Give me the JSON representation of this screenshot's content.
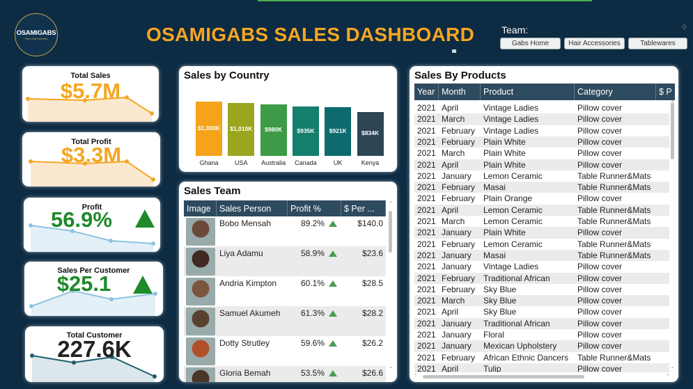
{
  "header": {
    "logo_text": "OSAMIGABS",
    "logo_subtext": "Fibre Craft Industries",
    "title": "OSAMIGABS SALES DASHBOARD",
    "team_label": "Team:",
    "team_buttons": [
      "Gabs Home",
      "Hair Accessories",
      "Tablewares"
    ]
  },
  "colors": {
    "background": "#0d2b42",
    "title": "#f5a623",
    "orange": "#f5a623",
    "green": "#1e8a2a",
    "dark": "#222222"
  },
  "kpis": [
    {
      "label": "Total Sales",
      "value": "$5.7M",
      "color": "#f5a623",
      "trend": "orange-area"
    },
    {
      "label": "Total Profit",
      "value": "$3.3M",
      "color": "#f5a623",
      "trend": "orange-area"
    },
    {
      "label": "Profit",
      "value": "56.9%",
      "color": "#1e8a2a",
      "icon": "up-triangle-icon",
      "trend": "blue-area"
    },
    {
      "label": "Sales Per Customer",
      "value": "$25.1",
      "color": "#1e8a2a",
      "icon": "up-triangle-icon",
      "trend": "blue-area"
    },
    {
      "label": "Total Customer",
      "value": "227.6K",
      "color": "#222222",
      "trend": "teal-area"
    }
  ],
  "sales_by_country": {
    "title": "Sales by Country",
    "chart_data": {
      "type": "bar",
      "categories": [
        "Ghana",
        "USA",
        "Australia",
        "Canada",
        "UK",
        "Kenya"
      ],
      "values": [
        1030,
        1010,
        980,
        935,
        921,
        834
      ],
      "data_labels": [
        "$1,030K",
        "$1,010K",
        "$980K",
        "$935K",
        "$921K",
        "$834K"
      ],
      "colors": [
        "#f5a31a",
        "#9aa71e",
        "#3d9b48",
        "#147f6c",
        "#0d6a6e",
        "#2d4656"
      ]
    }
  },
  "sales_team": {
    "title": "Sales Team",
    "columns": [
      "Image",
      "Sales Person",
      "Profit %",
      "$ Per ..."
    ],
    "rows": [
      {
        "name": "Bobo Mensah",
        "profit": "89.2%",
        "per": "$140.0"
      },
      {
        "name": "Liya Adamu",
        "profit": "58.9%",
        "per": "$23.6"
      },
      {
        "name": "Andria Kimpton",
        "profit": "60.1%",
        "per": "$28.5"
      },
      {
        "name": "Samuel Akumeh",
        "profit": "61.3%",
        "per": "$28.2"
      },
      {
        "name": "Dotty Strutley",
        "profit": "59.6%",
        "per": "$26.2"
      },
      {
        "name": "Gloria Bemah",
        "profit": "53.5%",
        "per": "$26.6"
      }
    ]
  },
  "sales_by_products": {
    "title": "Sales By Products",
    "columns": [
      "Year",
      "Month",
      "Product",
      "Category",
      "$ P"
    ],
    "rows": [
      [
        "2021",
        "April",
        "Vintage Ladies",
        "Pillow cover"
      ],
      [
        "2021",
        "March",
        "Vintage Ladies",
        "Pillow cover"
      ],
      [
        "2021",
        "February",
        "Vintage Ladies",
        "Pillow cover"
      ],
      [
        "2021",
        "February",
        "Plain White",
        "Pillow cover"
      ],
      [
        "2021",
        "March",
        "Plain White",
        "Pillow cover"
      ],
      [
        "2021",
        "April",
        "Plain White",
        "Pillow cover"
      ],
      [
        "2021",
        "January",
        "Lemon Ceramic",
        "Table Runner&Mats"
      ],
      [
        "2021",
        "February",
        "Masai",
        "Table Runner&Mats"
      ],
      [
        "2021",
        "February",
        "Plain Orange",
        "Pillow cover"
      ],
      [
        "2021",
        "April",
        "Lemon Ceramic",
        "Table Runner&Mats"
      ],
      [
        "2021",
        "March",
        "Lemon Ceramic",
        "Table Runner&Mats"
      ],
      [
        "2021",
        "January",
        "Plain White",
        "Pillow cover"
      ],
      [
        "2021",
        "February",
        "Lemon Ceramic",
        "Table Runner&Mats"
      ],
      [
        "2021",
        "January",
        "Masai",
        "Table Runner&Mats"
      ],
      [
        "2021",
        "January",
        "Vintage Ladies",
        "Pillow cover"
      ],
      [
        "2021",
        "February",
        "Traditional African",
        "Pillow cover"
      ],
      [
        "2021",
        "February",
        "Sky Blue",
        "Pillow cover"
      ],
      [
        "2021",
        "March",
        "Sky Blue",
        "Pillow cover"
      ],
      [
        "2021",
        "April",
        "Sky Blue",
        "Pillow cover"
      ],
      [
        "2021",
        "January",
        "Traditional African",
        "Pillow cover"
      ],
      [
        "2021",
        "January",
        "Floral",
        "Pillow cover"
      ],
      [
        "2021",
        "January",
        "Mexican Upholstery",
        "Pillow cover"
      ],
      [
        "2021",
        "February",
        "African Ethnic Dancers",
        "Table Runner&Mats"
      ],
      [
        "2021",
        "April",
        "Tulip",
        "Pillow cover"
      ]
    ]
  }
}
